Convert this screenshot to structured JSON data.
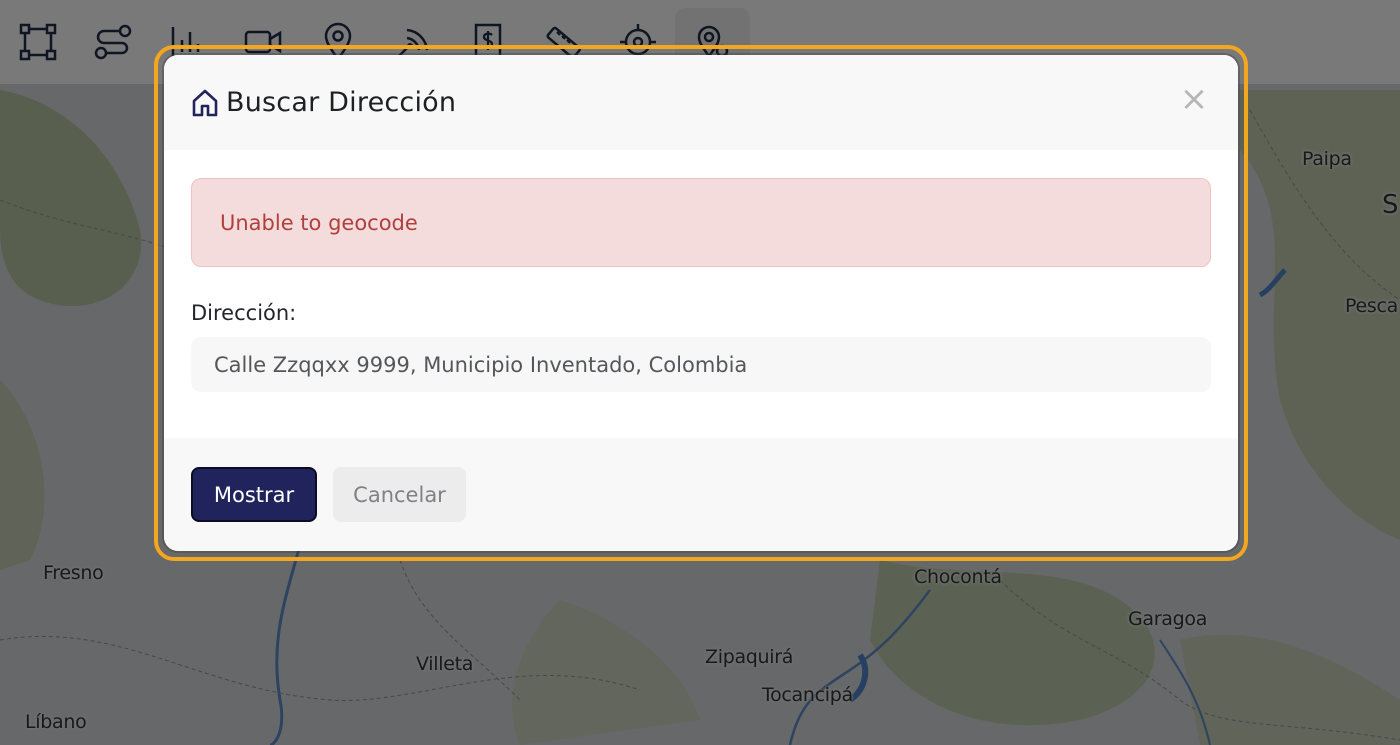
{
  "map": {
    "labels": [
      {
        "text": "Paipa"
      },
      {
        "text": "S"
      },
      {
        "text": "Pesca"
      },
      {
        "text": "Fresno"
      },
      {
        "text": "Chocontá"
      },
      {
        "text": "Garagoa"
      },
      {
        "text": "Villeta"
      },
      {
        "text": "Zipaquirá"
      },
      {
        "text": "Tocancipá"
      },
      {
        "text": "Líbano"
      }
    ]
  },
  "toolbar": {
    "tools": [
      {
        "icon": "polygon-select-icon"
      },
      {
        "icon": "route-icon"
      },
      {
        "icon": "bar-chart-icon"
      },
      {
        "icon": "video-camera-icon"
      },
      {
        "icon": "map-pin-icon"
      },
      {
        "icon": "satellite-signal-icon"
      },
      {
        "icon": "receipt-dollar-icon"
      },
      {
        "icon": "ruler-icon"
      },
      {
        "icon": "crosshair-icon"
      },
      {
        "icon": "location-search-icon",
        "active": true
      }
    ]
  },
  "modal": {
    "title": "Buscar Dirección",
    "title_icon": "home-icon",
    "close_label": "×",
    "alert": {
      "text": "Unable to geocode"
    },
    "address_label": "Dirección:",
    "address_value": "Calle Zzqqxx 9999, Municipio Inventado, Colombia",
    "show_button": "Mostrar",
    "cancel_button": "Cancelar"
  },
  "colors": {
    "accent": "#20235c",
    "focus_ring": "#f3a620",
    "alert_bg": "#f5dcdc",
    "alert_text": "#b0403c"
  }
}
